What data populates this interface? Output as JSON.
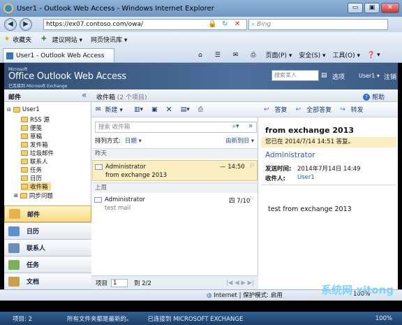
{
  "window": {
    "title": "User1 - Outlook Web Access - Windows Internet Explorer",
    "min": "▭",
    "max": "▣",
    "close": "✕"
  },
  "address": {
    "url": "https://ex07.contoso.com/owa/",
    "search_placeholder": "Bing"
  },
  "favorites": {
    "label": "收藏夹",
    "items": [
      "建议网站 ▾",
      "网页快讯库 ▾"
    ]
  },
  "tab": {
    "title": "User1 - Outlook Web Access"
  },
  "commands": {
    "page": "页面(P) ▾",
    "safety": "安全(S) ▾",
    "tools": "工具(O) ▾",
    "help": "❓ ▾"
  },
  "owa": {
    "ms": "Microsoft",
    "brand": "Office Outlook Web Access",
    "sub": "已连接到 Microsoft Exchange",
    "find_placeholder": "搜索某人",
    "options": "选项",
    "user": "User1 ▾",
    "logout": "注销"
  },
  "left": {
    "title": "邮件",
    "collapse": "«",
    "tree": [
      {
        "label": "User1"
      },
      {
        "label": "RSS 源"
      },
      {
        "label": "便笺"
      },
      {
        "label": "草稿"
      },
      {
        "label": "发件箱"
      },
      {
        "label": "垃圾邮件"
      },
      {
        "label": "联系人"
      },
      {
        "label": "任务"
      },
      {
        "label": "日历"
      },
      {
        "label": "收件箱"
      },
      {
        "label": "同步问题"
      }
    ],
    "nav": [
      "邮件",
      "日历",
      "联系人",
      "任务",
      "文档"
    ]
  },
  "mid": {
    "title": "收件箱",
    "count": "(2 个项目)",
    "new": "新建 ▾",
    "search_placeholder": "搜索 收件箱",
    "sort_label": "排列方式:",
    "sort_value": "日期 ▾",
    "sort_order": "由新到旧 ▾",
    "groups": [
      "昨天",
      "上周"
    ],
    "messages": [
      {
        "from": "Administrator",
        "subject": "from exchange 2013",
        "time": "— 14:50"
      },
      {
        "from": "Administrator",
        "subject": "test mail",
        "time": "四 7/10"
      }
    ],
    "footer_items": "项目",
    "page_value": "1",
    "page_total": "到 2/2",
    "pager": "|◀ ◀ ▶ ▶|"
  },
  "read": {
    "reply": "答复",
    "reply_all": "全部答复",
    "forward": "转发",
    "help": "帮助",
    "subject": "from exchange 2013",
    "info": "您已在 2014/7/14 14:51 答复。",
    "sender": "Administrator",
    "sent_label": "发送时间:",
    "sent_value": "2014年7月14日 14:49",
    "to_label": "收件人:",
    "to_value": "User1",
    "body": "test from exchange 2013"
  },
  "status": {
    "zone": "Internet | 保护模式: 启用",
    "zoom": "100%"
  },
  "taskbar": {
    "items": "项目: 2",
    "folders": "所有文件夹都是最新的。",
    "conn": "已连接到 MICROSOFT EXCHANGE",
    "zoom": "100%"
  },
  "watermark": "系统网 xitong"
}
